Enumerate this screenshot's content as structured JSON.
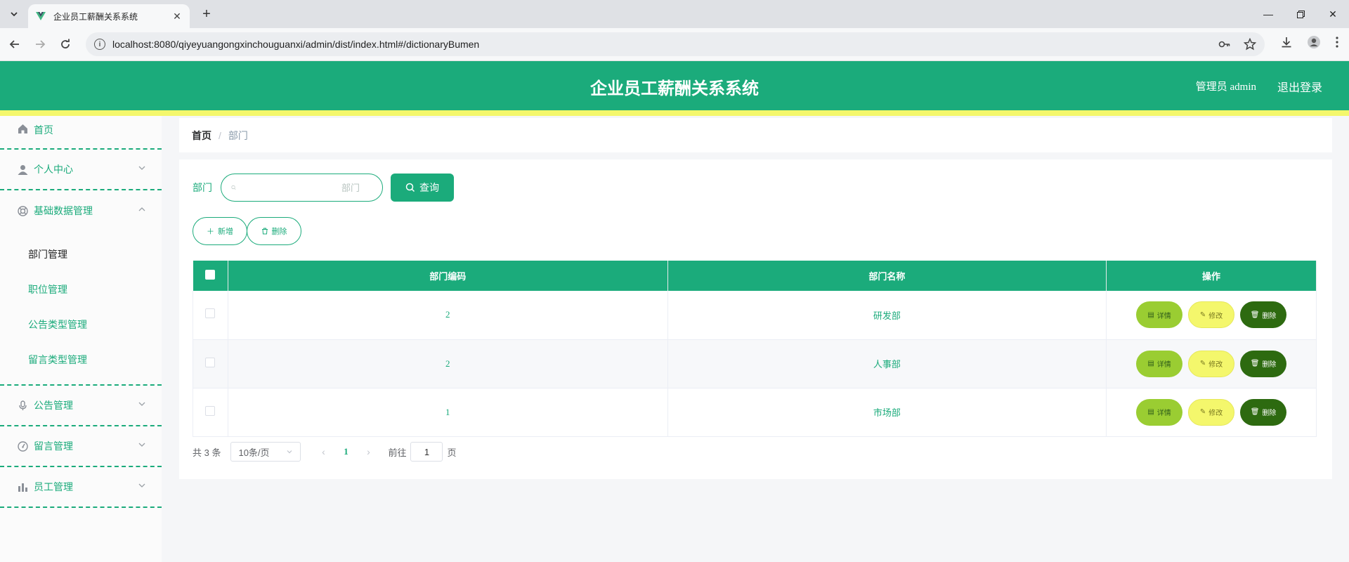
{
  "browser": {
    "tab_title": "企业员工薪酬关系系统",
    "url": "localhost:8080/qiyeyuangongxinchouguanxi/admin/dist/index.html#/dictionaryBumen"
  },
  "header": {
    "title": "企业员工薪酬关系系统",
    "user": "管理员 admin",
    "logout": "退出登录"
  },
  "sidebar": {
    "home": "首页",
    "personal": "个人中心",
    "basic_data": "基础数据管理",
    "sub_items": [
      "部门管理",
      "职位管理",
      "公告类型管理",
      "留言类型管理"
    ],
    "notice": "公告管理",
    "message": "留言管理",
    "staff": "员工管理"
  },
  "breadcrumb": {
    "home": "首页",
    "separator": "/",
    "current": "部门"
  },
  "search": {
    "label": "部门",
    "placeholder": "部门",
    "value": "",
    "query_label": "查询"
  },
  "actions": {
    "add": "新增",
    "delete": "删除"
  },
  "table": {
    "headers": [
      "部门编码",
      "部门名称",
      "操作"
    ],
    "rows": [
      {
        "code": "2",
        "name": "研发部"
      },
      {
        "code": "2",
        "name": "人事部"
      },
      {
        "code": "1",
        "name": "市场部"
      }
    ],
    "row_actions": {
      "detail": "详情",
      "edit": "修改",
      "delete": "删除"
    }
  },
  "pagination": {
    "total": "共 3 条",
    "page_size": "10条/页",
    "current_page": "1",
    "goto_label": "前往",
    "goto_value": "1",
    "page_suffix": "页"
  },
  "colors": {
    "primary": "#1bab7b",
    "accent_stripe": "#f4f76c",
    "detail_btn": "#9acd32",
    "edit_btn": "#f4f76c",
    "delete_btn": "#2d6a10"
  }
}
